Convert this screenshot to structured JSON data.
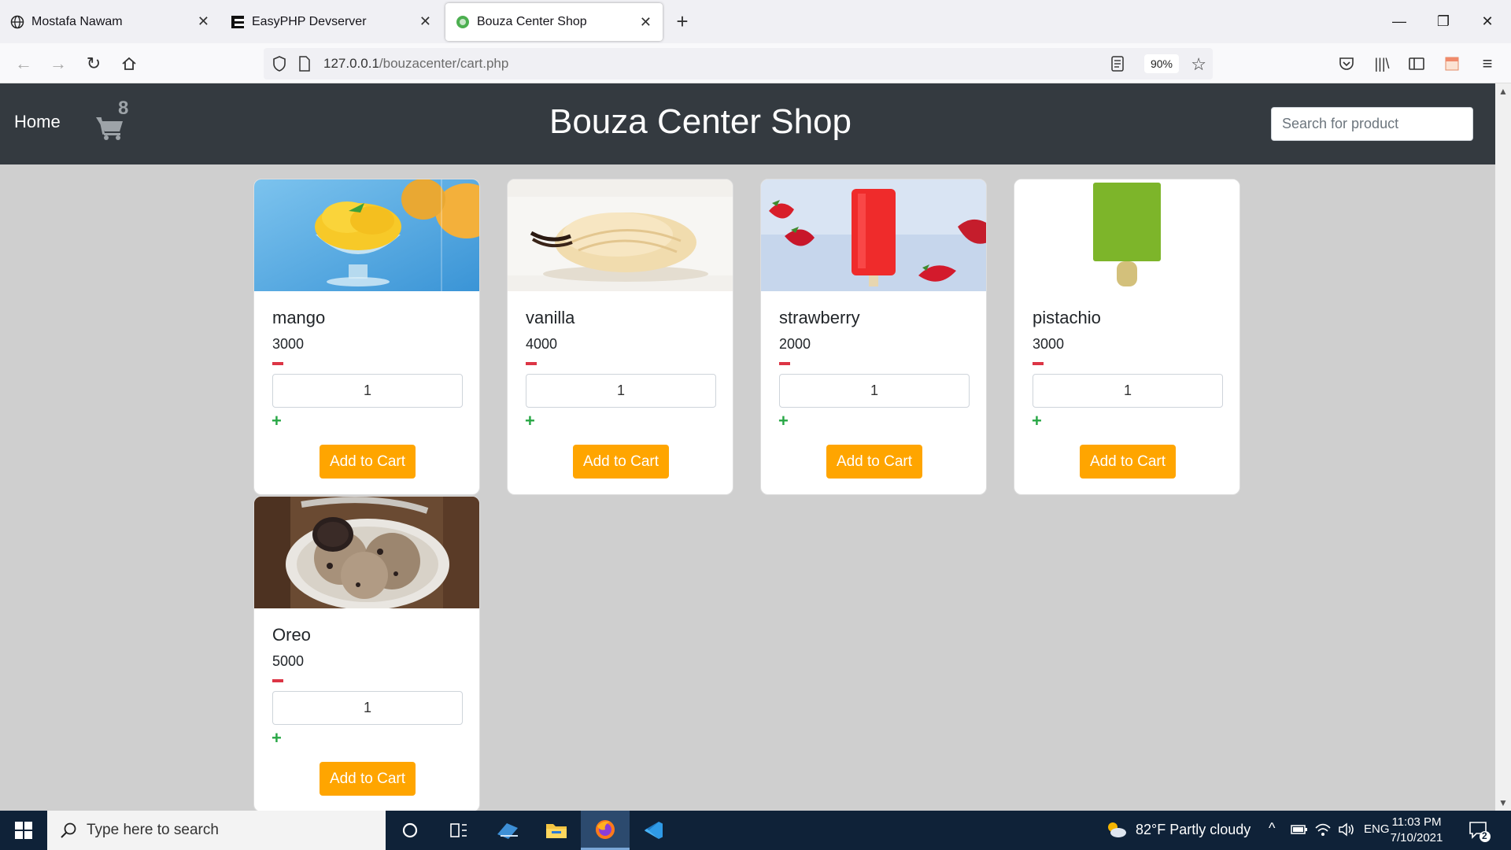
{
  "browser": {
    "tabs": [
      {
        "title": "Mostafa Nawam",
        "icon": "globe-icon"
      },
      {
        "title": "EasyPHP Devserver",
        "icon": "easyphp-icon"
      },
      {
        "title": "Bouza Center Shop",
        "icon": "site-icon",
        "active": true
      }
    ],
    "url_host": "127.0.0.1",
    "url_path": "/bouzacenter/cart.php",
    "zoom": "90%"
  },
  "site": {
    "home_label": "Home",
    "cart_count": "8",
    "title": "Bouza Center Shop",
    "search_placeholder": "Search for product"
  },
  "products": [
    {
      "name": "mango",
      "price": "3000",
      "qty": "1",
      "button": "Add to Cart"
    },
    {
      "name": "vanilla",
      "price": "4000",
      "qty": "1",
      "button": "Add to Cart"
    },
    {
      "name": "strawberry",
      "price": "2000",
      "qty": "1",
      "button": "Add to Cart"
    },
    {
      "name": "pistachio",
      "price": "3000",
      "qty": "1",
      "button": "Add to Cart"
    },
    {
      "name": "Oreo",
      "price": "5000",
      "qty": "1",
      "button": "Add to Cart"
    }
  ],
  "taskbar": {
    "search_placeholder": "Type here to search",
    "weather": "82°F  Partly cloudy",
    "lang": "ENG",
    "time": "11:03 PM",
    "date": "7/10/2021",
    "notifications": "2"
  },
  "colors": {
    "header_bg": "#343a40",
    "add_button": "#ffa500",
    "minus": "#dc3545",
    "plus": "#28a745"
  }
}
